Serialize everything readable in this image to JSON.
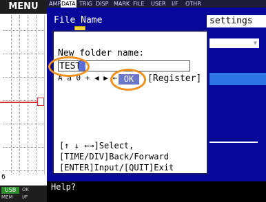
{
  "sidebar": {
    "menu_title": "MENU",
    "bottom_number": "6",
    "status": {
      "usb": "USB",
      "mem": "MEM",
      "ok": "OK",
      "iv": "I/F"
    }
  },
  "tabs": [
    {
      "label": "AMP",
      "active": false
    },
    {
      "label": "DATA",
      "active": true
    },
    {
      "label": "TRIG",
      "active": false
    },
    {
      "label": "DISP",
      "active": false
    },
    {
      "label": "MARK",
      "active": false
    },
    {
      "label": "FILE",
      "active": false
    },
    {
      "label": "USER",
      "active": false
    },
    {
      "label": "I/F",
      "active": false
    },
    {
      "label": "OTHR",
      "active": false
    }
  ],
  "panel": {
    "file_name_label": "File Name",
    "settings_label": "settings"
  },
  "dialog": {
    "new_folder_label": "New folder name:",
    "folder_value": "TEST",
    "charset": "A a 0 + ◀ ▶ ← ↓",
    "ok_label": "OK",
    "register_label": "[Register]",
    "help_lines": [
      "[↑ ↓ ←→]Select,",
      "[TIME/DIV]Back/Forward",
      "[ENTER]Input/[QUIT]Exit"
    ]
  },
  "helpbar": {
    "label": "Help?"
  },
  "colors": {
    "panel_blue": "#07079a",
    "highlight": "#2d74e6",
    "annotation_orange": "#f0901f",
    "trace_red": "#d43030"
  }
}
